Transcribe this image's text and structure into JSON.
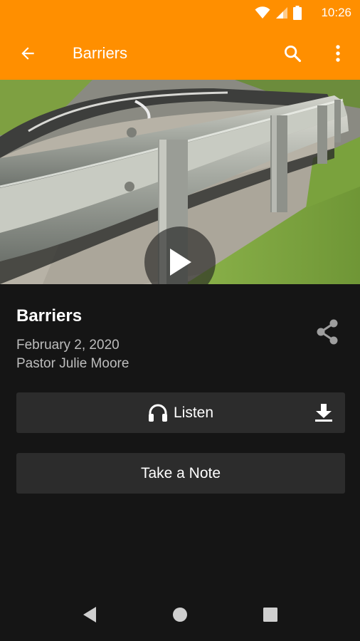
{
  "status_bar": {
    "time": "10:26",
    "icons": [
      "wifi-icon",
      "signal-icon",
      "battery-icon"
    ]
  },
  "app_bar": {
    "title": "Barriers",
    "color": "#FF8F00",
    "icons": [
      "back-arrow-icon",
      "search-icon",
      "more-vert-icon"
    ]
  },
  "media": {
    "play_icon": "play-icon"
  },
  "sermon": {
    "title": "Barriers",
    "date": "February 2, 2020",
    "speaker": "Pastor Julie Moore"
  },
  "actions": {
    "listen_label": "Listen",
    "note_label": "Take a Note"
  },
  "nav": {
    "icons": [
      "nav-back-icon",
      "nav-home-icon",
      "nav-recents-icon"
    ]
  },
  "colors": {
    "accent": "#FF8F00",
    "background": "#151515",
    "button": "#2c2c2c"
  }
}
